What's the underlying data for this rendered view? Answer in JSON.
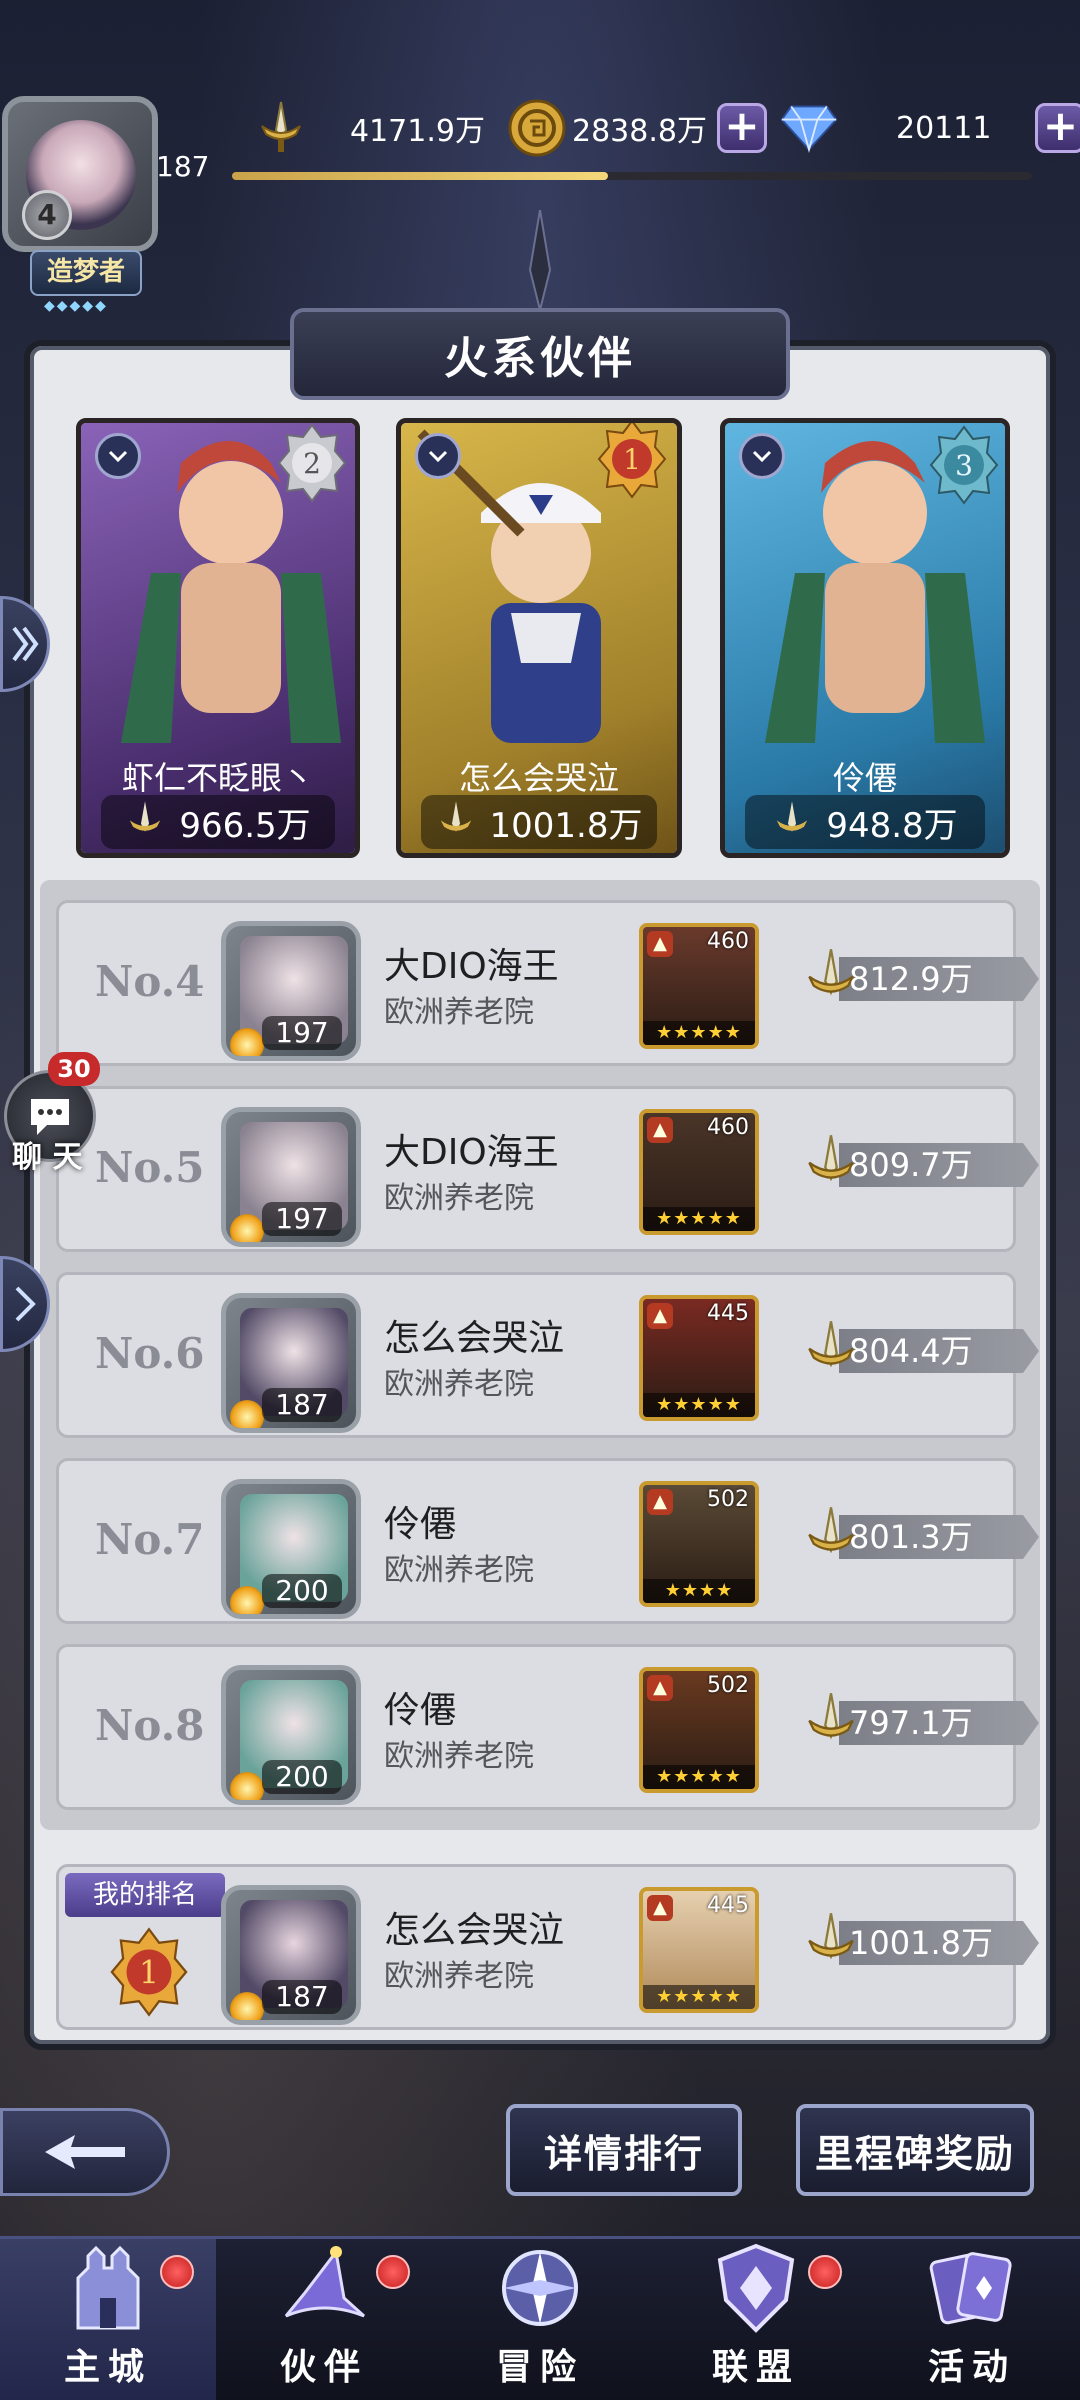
{
  "resources": {
    "power": "4171.9万",
    "gold": "2838.8万",
    "gems": "20111"
  },
  "player": {
    "level": "187",
    "vip": "4",
    "title": "造梦者",
    "xp_progress": 0.47
  },
  "panel": {
    "title": "火系伙伴"
  },
  "podium": [
    {
      "rank": "2",
      "name": "虾仁不眨眼丶",
      "power": "966.5万",
      "medal_color": "#b9b9c0",
      "bg": "#6c4c96"
    },
    {
      "rank": "1",
      "name": "怎么会哭泣",
      "power": "1001.8万",
      "medal_color": "#e7a82f",
      "bg": "#b89432"
    },
    {
      "rank": "3",
      "name": "伶僊",
      "power": "948.8万",
      "medal_color": "#5fb3c9",
      "bg": "#2f8fb8"
    }
  ],
  "rows": [
    {
      "rank": "No.4",
      "name": "大DIO海王",
      "guild": "欧洲养老院",
      "level": "197",
      "hero_level": "460",
      "power": "812.9万",
      "stars": "★★★★★",
      "face": "#8a8290",
      "hero_bg": "#6a3a2c"
    },
    {
      "rank": "No.5",
      "name": "大DIO海王",
      "guild": "欧洲养老院",
      "level": "197",
      "hero_level": "460",
      "power": "809.7万",
      "stars": "★★★★★",
      "face": "#8a8290",
      "hero_bg": "#4a3528"
    },
    {
      "rank": "No.6",
      "name": "怎么会哭泣",
      "guild": "欧洲养老院",
      "level": "187",
      "hero_level": "445",
      "power": "804.4万",
      "stars": "★★★★★",
      "face": "#524a66",
      "hero_bg": "#7a2a22"
    },
    {
      "rank": "No.7",
      "name": "伶僊",
      "guild": "欧洲养老院",
      "level": "200",
      "hero_level": "502",
      "power": "801.3万",
      "stars": "★★★★",
      "face": "#6aa39a",
      "hero_bg": "#5a4a36"
    },
    {
      "rank": "No.8",
      "name": "伶僊",
      "guild": "欧洲养老院",
      "level": "200",
      "hero_level": "502",
      "power": "797.1万",
      "stars": "★★★★★",
      "face": "#6aa39a",
      "hero_bg": "#6a3a20"
    }
  ],
  "my_rank": {
    "tag": "我的排名",
    "rank": "1",
    "name": "怎么会哭泣",
    "guild": "欧洲养老院",
    "level": "187",
    "hero_level": "445",
    "power": "1001.8万",
    "stars": "★★★★★"
  },
  "chat": {
    "label": "聊 天",
    "badge": "30"
  },
  "actions": {
    "detail": "详情排行",
    "milestone": "里程碑奖励"
  },
  "nav": [
    {
      "label": "主城",
      "icon": "castle-icon",
      "active": true,
      "dot": true
    },
    {
      "label": "伙伴",
      "icon": "wizard-hat-icon",
      "active": false,
      "dot": true
    },
    {
      "label": "冒险",
      "icon": "compass-icon",
      "active": false,
      "dot": false
    },
    {
      "label": "联盟",
      "icon": "shield-icon",
      "active": false,
      "dot": true
    },
    {
      "label": "活动",
      "icon": "cards-icon",
      "active": false,
      "dot": false
    }
  ]
}
